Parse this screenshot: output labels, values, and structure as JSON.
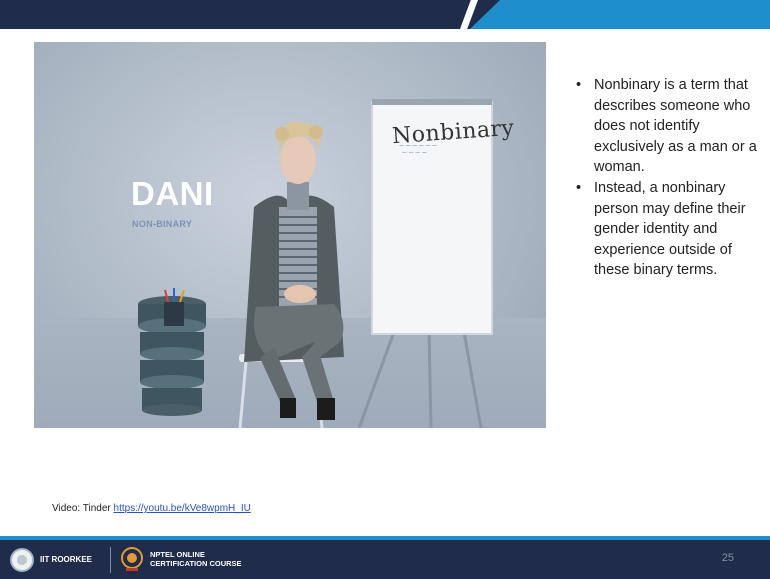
{
  "video": {
    "speaker_name": "DANI",
    "speaker_identity": "NON-BINARY",
    "flipchart_title": "Nonbinary"
  },
  "bullets": [
    "Nonbinary is a term that describes someone who does not identify exclusively as a man or a woman.",
    "Instead, a nonbinary person may define their gender identity and experience outside of these binary terms."
  ],
  "credit": {
    "prefix": "Video: Tinder",
    "link": "https://youtu.be/kVe8wpmH_IU"
  },
  "footer": {
    "institute": "IIT ROORKEE",
    "course_line1": "NPTEL ONLINE",
    "course_line2": "CERTIFICATION COURSE",
    "page_number": "25"
  },
  "colors": {
    "navy": "#1f2d4a",
    "accent_blue": "#1f8fcb"
  }
}
